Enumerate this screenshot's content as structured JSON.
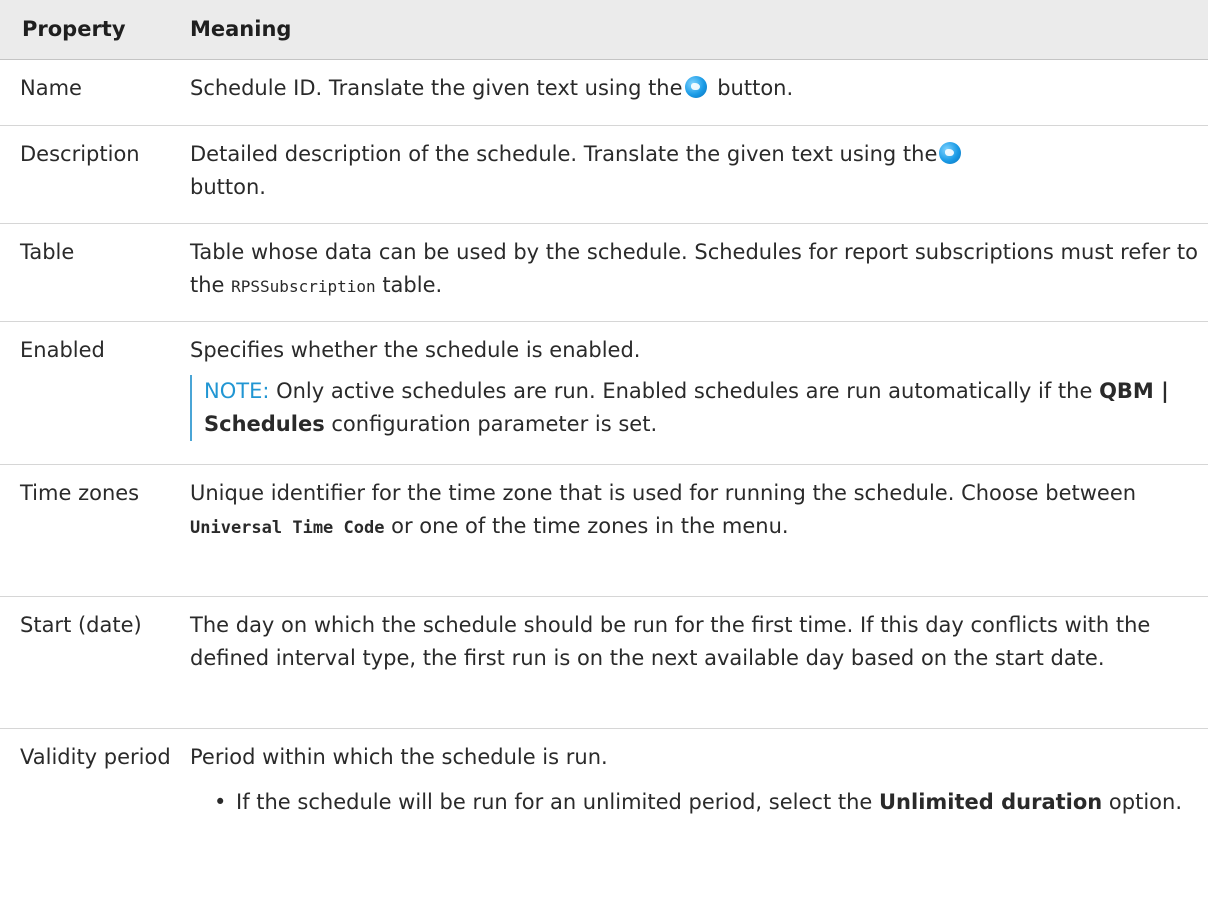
{
  "header": {
    "property": "Property",
    "meaning": "Meaning"
  },
  "rows": [
    {
      "property": "Name",
      "meaning_before": "Schedule ID. Translate the given text using the",
      "meaning_after": " button."
    },
    {
      "property": "Description",
      "meaning_before": "Detailed description of the schedule. Translate the given text using the",
      "meaning_after": " button."
    },
    {
      "property": "Table",
      "meaning_before": "Table whose data can be used by the schedule. Schedules for report subscriptions must refer to the ",
      "code": "RPSSubscription",
      "meaning_after": " table."
    },
    {
      "property": "Enabled",
      "meaning": "Specifies whether the schedule is enabled.",
      "note_label": "NOTE:",
      "note_before": " Only active schedules are run. Enabled schedules are run automatically if the ",
      "note_bold": "QBM | Schedules",
      "note_after": " configuration parameter is set."
    },
    {
      "property": "Time zones",
      "meaning_before": "Unique identifier for the time zone that is used for running the schedule. Choose between ",
      "code": "Universal Time Code",
      "meaning_after": " or one of the time zones in the menu."
    },
    {
      "property": "Start (date)",
      "meaning": "The day on which the schedule should be run for the first time. If this day conflicts with the defined interval type, the first run is on the next available day based on the start date."
    },
    {
      "property": "Validity period",
      "meaning": "Period within which the schedule is run.",
      "bullet_before": "If the schedule will be run for an unlimited period, select the ",
      "bullet_bold": "Unlimited duration",
      "bullet_after": " option."
    }
  ],
  "icons": {
    "translate": "globe-icon"
  },
  "colors": {
    "header_bg": "#ebebeb",
    "note_blue": "#2196d3",
    "row_border": "#d6d6d6"
  }
}
